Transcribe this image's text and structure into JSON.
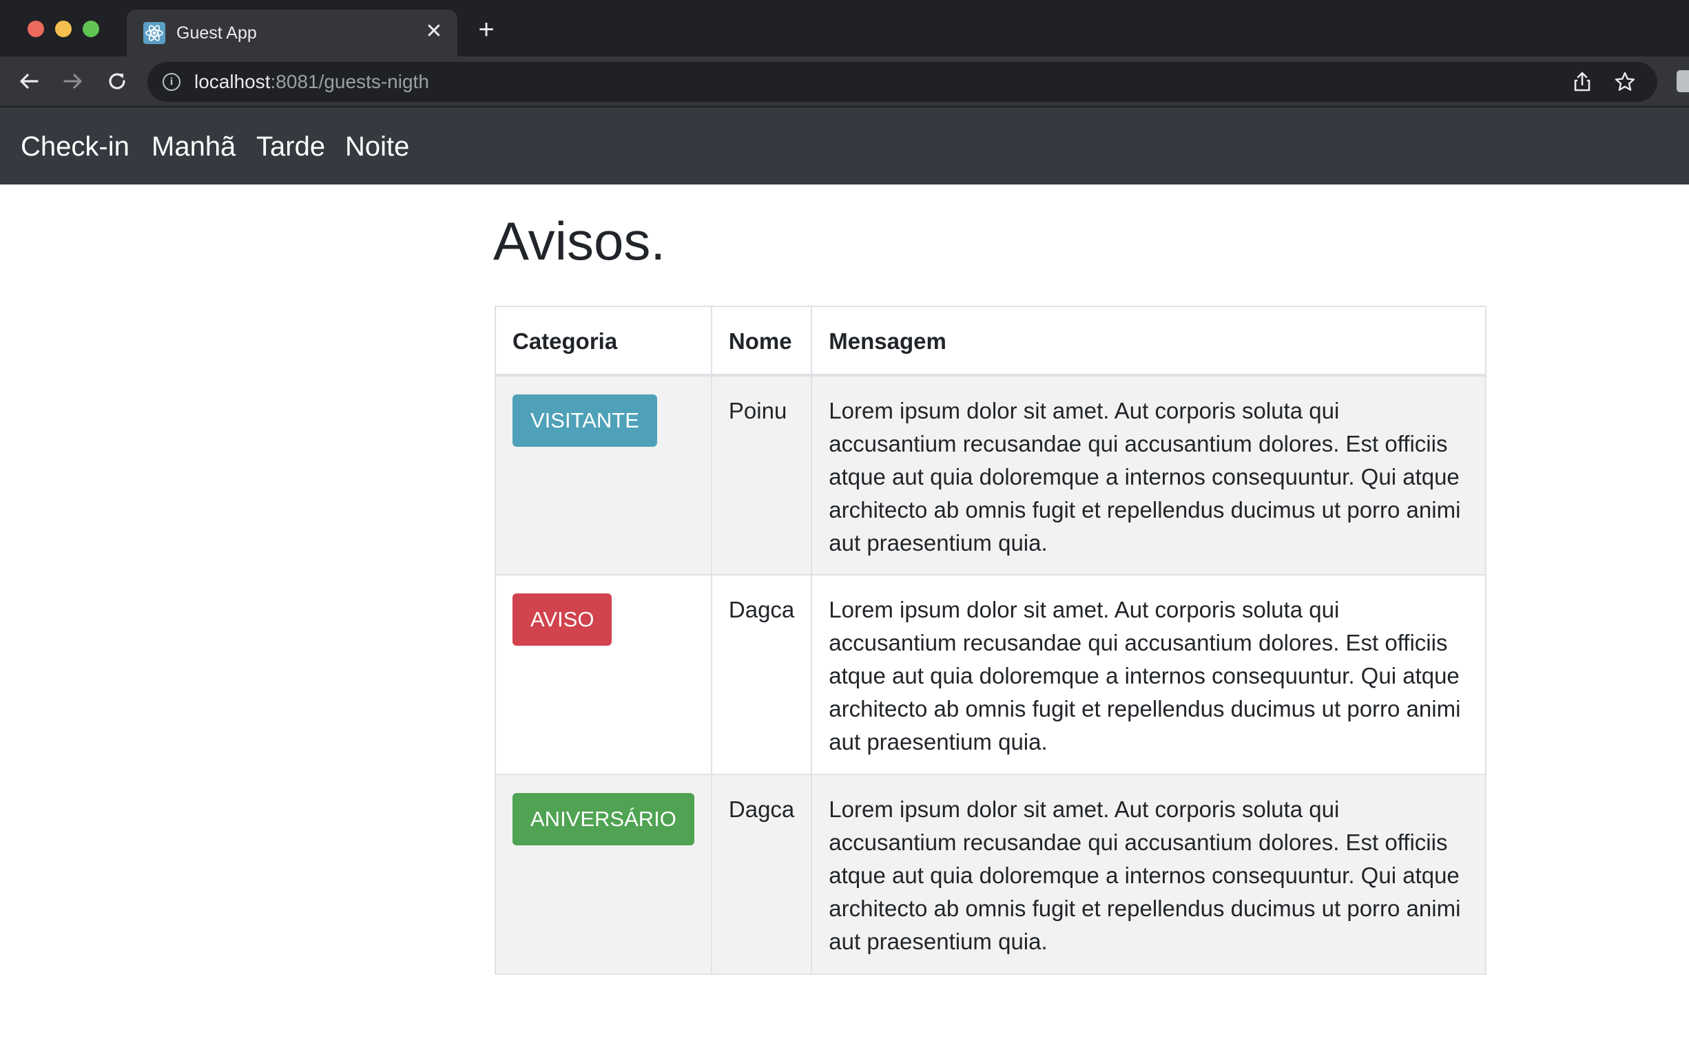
{
  "browser": {
    "tab_title": "Guest App",
    "tab_close": "✕",
    "new_tab": "+",
    "url_host": "localhost",
    "url_rest": ":8081/guests-nigth",
    "icons": [
      "back-icon",
      "forward-icon",
      "reload-icon",
      "info-icon",
      "share-icon",
      "star-icon",
      "react-favicon",
      "extension-icon"
    ]
  },
  "navbar": {
    "links": [
      "Check-in",
      "Manhã",
      "Tarde",
      "Noite"
    ]
  },
  "page": {
    "title": "Avisos."
  },
  "table": {
    "headers": [
      "Categoria",
      "Nome",
      "Mensagem"
    ],
    "rows": [
      {
        "categoria": "VISITANTE",
        "nome": "Poinu",
        "mensagem": "Lorem ipsum dolor sit amet. Aut corporis soluta qui accusantium recusandae qui accusantium dolores. Est officiis atque aut quia doloremque a internos consequuntur. Qui atque architecto ab omnis fugit et repellendus ducimus ut porro animi aut praesentium quia."
      },
      {
        "categoria": "AVISO",
        "nome": "Dagca",
        "mensagem": "Lorem ipsum dolor sit amet. Aut corporis soluta qui accusantium recusandae qui accusantium dolores. Est officiis atque aut quia doloremque a internos consequuntur. Qui atque architecto ab omnis fugit et repellendus ducimus ut porro animi aut praesentium quia."
      },
      {
        "categoria": "ANIVERSÁRIO",
        "nome": "Dagca",
        "mensagem": "Lorem ipsum dolor sit amet. Aut corporis soluta qui accusantium recusandae qui accusantium dolores. Est officiis atque aut quia doloremque a internos consequuntur. Qui atque architecto ab omnis fugit et repellendus ducimus ut porro animi aut praesentium quia."
      }
    ]
  },
  "colors": {
    "visitante": "#4ea1b8",
    "aviso": "#d1434d",
    "aniversario": "#4fa352",
    "navbar": "#343a40"
  }
}
